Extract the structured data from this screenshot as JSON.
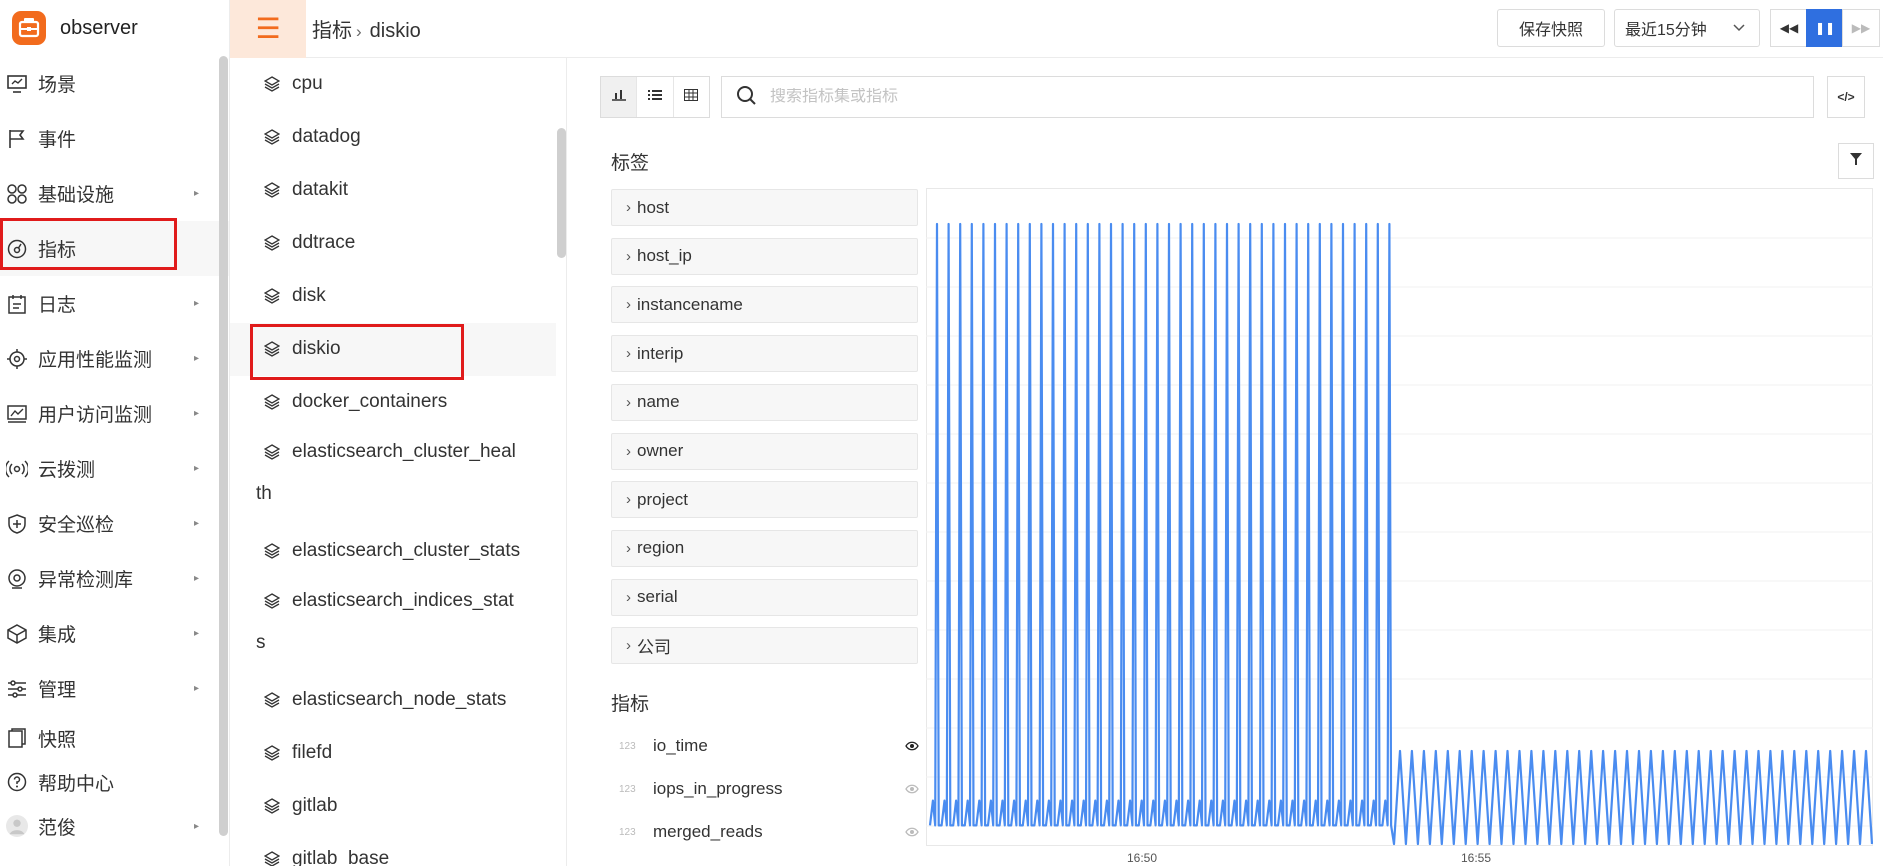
{
  "app": {
    "name": "observer"
  },
  "sidebar": {
    "items": [
      {
        "label": "场景",
        "icon": "dashboard-icon",
        "has_sub": false
      },
      {
        "label": "事件",
        "icon": "flag-icon",
        "has_sub": false
      },
      {
        "label": "基础设施",
        "icon": "grid-icon",
        "has_sub": true
      },
      {
        "label": "指标",
        "icon": "metric-icon",
        "has_sub": false,
        "active": true
      },
      {
        "label": "日志",
        "icon": "log-icon",
        "has_sub": true
      },
      {
        "label": "应用性能监测",
        "icon": "apm-icon",
        "has_sub": true
      },
      {
        "label": "用户访问监测",
        "icon": "rum-icon",
        "has_sub": true
      },
      {
        "label": "云拨测",
        "icon": "dial-icon",
        "has_sub": true
      },
      {
        "label": "安全巡检",
        "icon": "shield-icon",
        "has_sub": true
      },
      {
        "label": "异常检测库",
        "icon": "monitor-icon",
        "has_sub": true
      },
      {
        "label": "集成",
        "icon": "cube-icon",
        "has_sub": true
      },
      {
        "label": "管理",
        "icon": "sliders-icon",
        "has_sub": true
      },
      {
        "label": "快照",
        "icon": "snapshot-icon",
        "has_sub": false
      },
      {
        "label": "帮助中心",
        "icon": "help-icon",
        "has_sub": false
      },
      {
        "label": "范俊",
        "icon": "avatar",
        "has_sub": true
      }
    ]
  },
  "header": {
    "breadcrumb": [
      "指标",
      "diskio"
    ],
    "snapshot_label": "保存快照",
    "time_range": "最近15分钟"
  },
  "metric_sets": {
    "items": [
      {
        "first": "cpu"
      },
      {
        "first": "datadog"
      },
      {
        "first": "datakit"
      },
      {
        "first": "ddtrace"
      },
      {
        "first": "disk"
      },
      {
        "first": "diskio",
        "selected": true
      },
      {
        "first": "docker_containers"
      },
      {
        "first": "elasticsearch_cluster_heal",
        "rest": "th"
      },
      {
        "first": "elasticsearch_cluster_stats"
      },
      {
        "first": "elasticsearch_indices_stat",
        "rest": "s"
      },
      {
        "first": "elasticsearch_node_stats"
      },
      {
        "first": "filefd"
      },
      {
        "first": "gitlab"
      },
      {
        "first": "gitlab_base"
      }
    ]
  },
  "search": {
    "placeholder": "搜索指标集或指标"
  },
  "tags": {
    "title": "标签",
    "items": [
      "host",
      "host_ip",
      "instancename",
      "interip",
      "name",
      "owner",
      "project",
      "region",
      "serial",
      "公司"
    ]
  },
  "metrics": {
    "title": "指标",
    "type_badge": "123",
    "items": [
      {
        "name": "io_time",
        "visible": true
      },
      {
        "name": "iops_in_progress",
        "visible": false
      },
      {
        "name": "merged_reads",
        "visible": false
      }
    ]
  },
  "chart_data": {
    "type": "line",
    "x_ticks": [
      "16:50",
      "16:55"
    ],
    "series": [
      {
        "color": "#4a8cf0",
        "segments": [
          {
            "pattern": "spike",
            "count": 40,
            "high": 1.0,
            "low_min": 0.03,
            "low_mid": 0.07
          },
          {
            "pattern": "wave",
            "count": 40,
            "high": 0.15,
            "low": 0.0
          }
        ]
      }
    ],
    "grid": true,
    "colors": {
      "accent": "#f26b1d",
      "primary": "#2f6fe0",
      "highlight": "#e01b1b"
    }
  }
}
